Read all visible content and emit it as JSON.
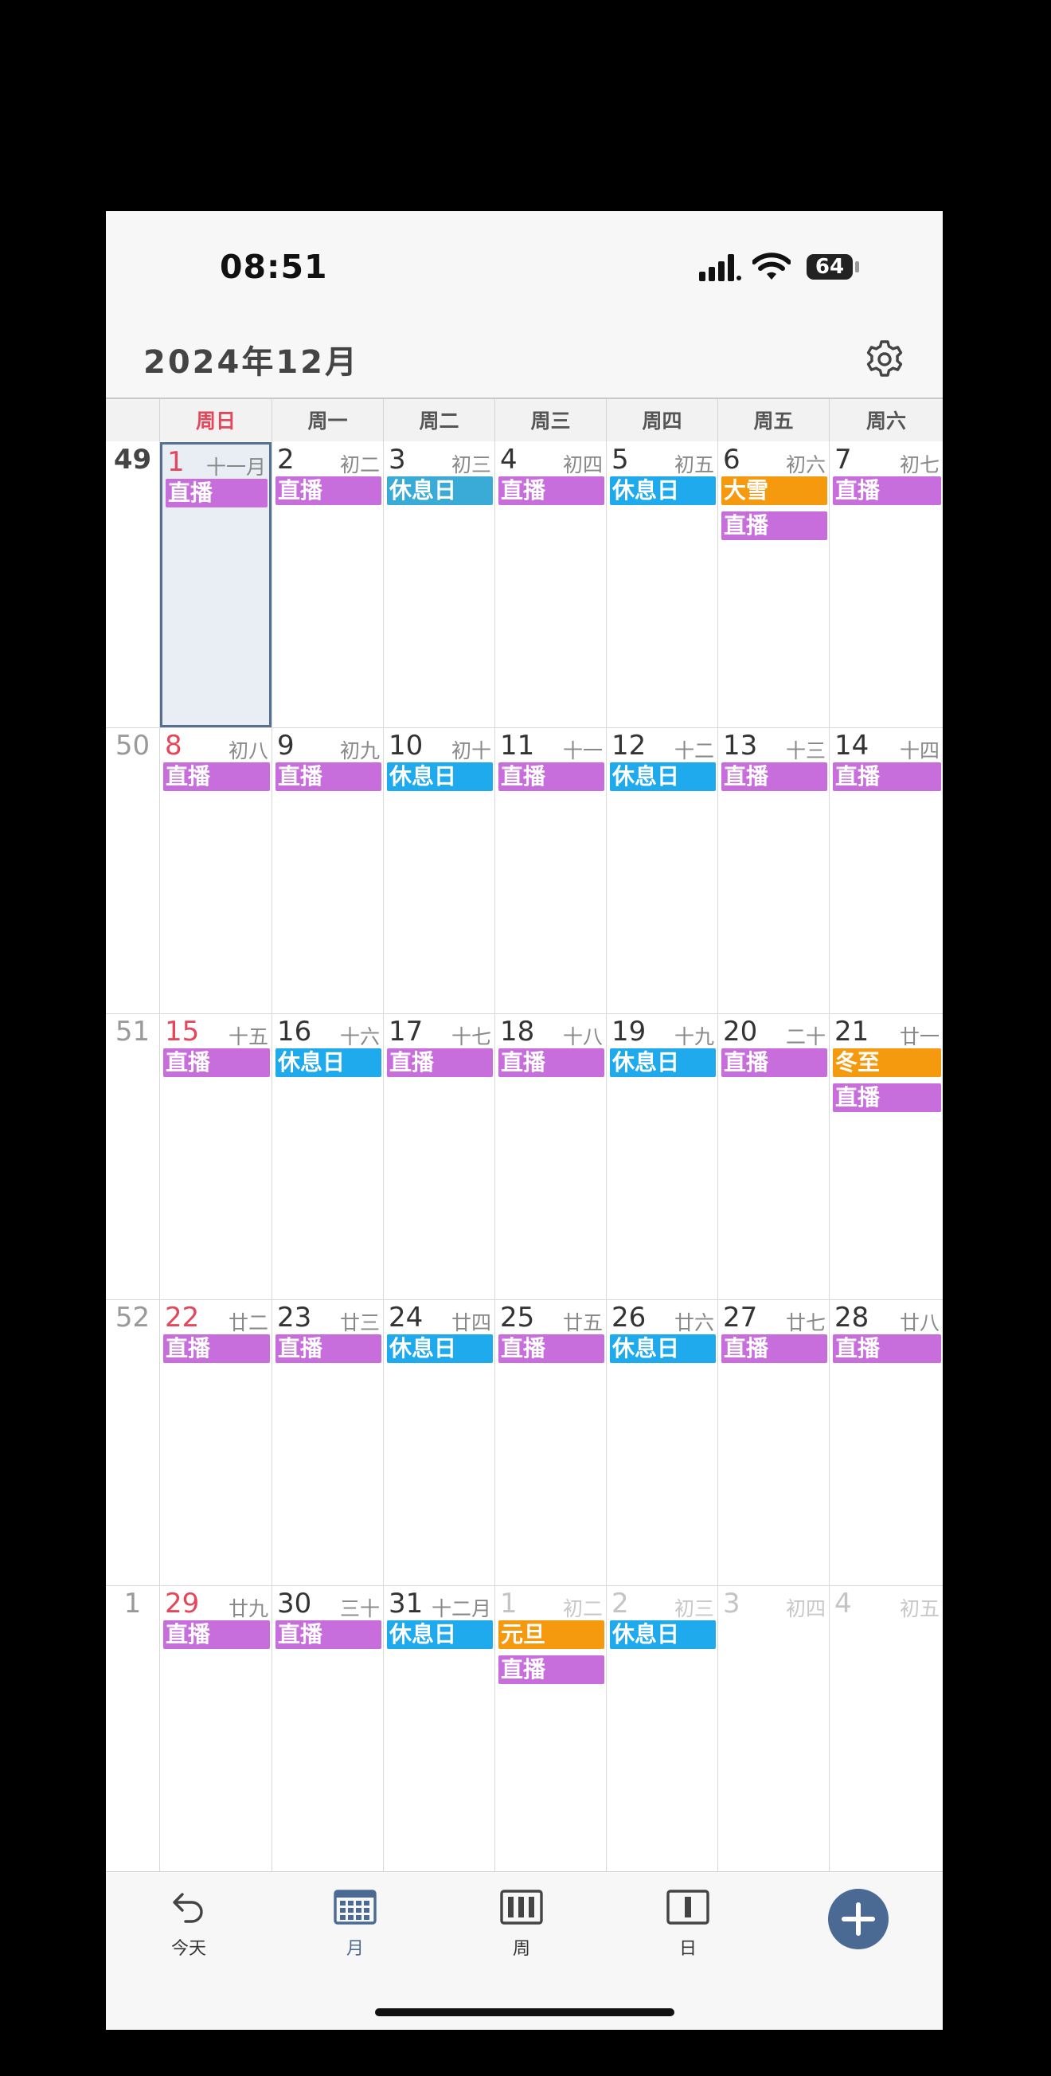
{
  "status_bar": {
    "time": "08:51",
    "battery": "64"
  },
  "header": {
    "title": "2024年12月"
  },
  "weekdays": [
    "周日",
    "周一",
    "周二",
    "周三",
    "周四",
    "周五",
    "周六"
  ],
  "colors": {
    "live": "#c86ddc",
    "rest": "#1eaaed",
    "rest_alt": "#3aaad6",
    "holiday": "#f59a0e",
    "accent": "#4a6a94",
    "sunday": "#e5465a"
  },
  "weeks": [
    {
      "num": "49",
      "bold": true,
      "days": [
        {
          "d": "1",
          "l": "十一月",
          "today": true,
          "ev": [
            {
              "t": "直播",
              "c": "live"
            }
          ]
        },
        {
          "d": "2",
          "l": "初二",
          "ev": [
            {
              "t": "直播",
              "c": "live"
            }
          ]
        },
        {
          "d": "3",
          "l": "初三",
          "ev": [
            {
              "t": "休息日",
              "c": "rest_alt"
            }
          ]
        },
        {
          "d": "4",
          "l": "初四",
          "ev": [
            {
              "t": "直播",
              "c": "live"
            }
          ]
        },
        {
          "d": "5",
          "l": "初五",
          "ev": [
            {
              "t": "休息日",
              "c": "rest"
            }
          ]
        },
        {
          "d": "6",
          "l": "初六",
          "ev": [
            {
              "t": "大雪",
              "c": "holiday"
            },
            {
              "t": "直播",
              "c": "live"
            }
          ]
        },
        {
          "d": "7",
          "l": "初七",
          "ev": [
            {
              "t": "直播",
              "c": "live"
            }
          ]
        }
      ]
    },
    {
      "num": "50",
      "days": [
        {
          "d": "8",
          "l": "初八",
          "ev": [
            {
              "t": "直播",
              "c": "live"
            }
          ]
        },
        {
          "d": "9",
          "l": "初九",
          "ev": [
            {
              "t": "直播",
              "c": "live"
            }
          ]
        },
        {
          "d": "10",
          "l": "初十",
          "ev": [
            {
              "t": "休息日",
              "c": "rest"
            }
          ]
        },
        {
          "d": "11",
          "l": "十一",
          "ev": [
            {
              "t": "直播",
              "c": "live"
            }
          ]
        },
        {
          "d": "12",
          "l": "十二",
          "ev": [
            {
              "t": "休息日",
              "c": "rest"
            }
          ]
        },
        {
          "d": "13",
          "l": "十三",
          "ev": [
            {
              "t": "直播",
              "c": "live"
            }
          ]
        },
        {
          "d": "14",
          "l": "十四",
          "ev": [
            {
              "t": "直播",
              "c": "live"
            }
          ]
        }
      ]
    },
    {
      "num": "51",
      "days": [
        {
          "d": "15",
          "l": "十五",
          "ev": [
            {
              "t": "直播",
              "c": "live"
            }
          ]
        },
        {
          "d": "16",
          "l": "十六",
          "ev": [
            {
              "t": "休息日",
              "c": "rest"
            }
          ]
        },
        {
          "d": "17",
          "l": "十七",
          "ev": [
            {
              "t": "直播",
              "c": "live"
            }
          ]
        },
        {
          "d": "18",
          "l": "十八",
          "ev": [
            {
              "t": "直播",
              "c": "live"
            }
          ]
        },
        {
          "d": "19",
          "l": "十九",
          "ev": [
            {
              "t": "休息日",
              "c": "rest"
            }
          ]
        },
        {
          "d": "20",
          "l": "二十",
          "ev": [
            {
              "t": "直播",
              "c": "live"
            }
          ]
        },
        {
          "d": "21",
          "l": "廿一",
          "ev": [
            {
              "t": "冬至",
              "c": "holiday"
            },
            {
              "t": "直播",
              "c": "live"
            }
          ]
        }
      ]
    },
    {
      "num": "52",
      "days": [
        {
          "d": "22",
          "l": "廿二",
          "ev": [
            {
              "t": "直播",
              "c": "live"
            }
          ]
        },
        {
          "d": "23",
          "l": "廿三",
          "ev": [
            {
              "t": "直播",
              "c": "live"
            }
          ]
        },
        {
          "d": "24",
          "l": "廿四",
          "ev": [
            {
              "t": "休息日",
              "c": "rest"
            }
          ]
        },
        {
          "d": "25",
          "l": "廿五",
          "ev": [
            {
              "t": "直播",
              "c": "live"
            }
          ]
        },
        {
          "d": "26",
          "l": "廿六",
          "ev": [
            {
              "t": "休息日",
              "c": "rest"
            }
          ]
        },
        {
          "d": "27",
          "l": "廿七",
          "ev": [
            {
              "t": "直播",
              "c": "live"
            }
          ]
        },
        {
          "d": "28",
          "l": "廿八",
          "ev": [
            {
              "t": "直播",
              "c": "live"
            }
          ]
        }
      ]
    },
    {
      "num": "1",
      "days": [
        {
          "d": "29",
          "l": "廿九",
          "ev": [
            {
              "t": "直播",
              "c": "live"
            }
          ]
        },
        {
          "d": "30",
          "l": "三十",
          "ev": [
            {
              "t": "直播",
              "c": "live"
            }
          ]
        },
        {
          "d": "31",
          "l": "十二月",
          "ev": [
            {
              "t": "休息日",
              "c": "rest"
            }
          ]
        },
        {
          "d": "1",
          "l": "初二",
          "dim": true,
          "ev": [
            {
              "t": "元旦",
              "c": "holiday"
            },
            {
              "t": "直播",
              "c": "live"
            }
          ]
        },
        {
          "d": "2",
          "l": "初三",
          "dim": true,
          "ev": [
            {
              "t": "休息日",
              "c": "rest"
            }
          ]
        },
        {
          "d": "3",
          "l": "初四",
          "dim": true,
          "ev": []
        },
        {
          "d": "4",
          "l": "初五",
          "dim": true,
          "ev": []
        }
      ]
    }
  ],
  "tabs": [
    {
      "label": "今天",
      "icon": "undo-arrow-icon",
      "active": false
    },
    {
      "label": "月",
      "icon": "month-grid-icon",
      "active": true
    },
    {
      "label": "周",
      "icon": "week-columns-icon",
      "active": false
    },
    {
      "label": "日",
      "icon": "day-view-icon",
      "active": false
    }
  ],
  "fab_icon": "plus-icon"
}
